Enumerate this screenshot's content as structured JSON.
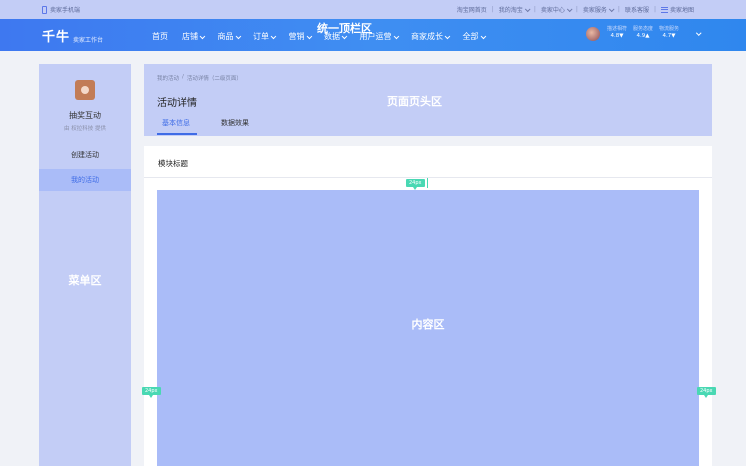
{
  "utilbar": {
    "left_label": "卖家手机端",
    "links": [
      {
        "label": "淘宝网首页",
        "dropdown": false
      },
      {
        "label": "我的淘宝",
        "dropdown": true
      },
      {
        "label": "卖家中心",
        "dropdown": true
      },
      {
        "label": "卖家服务",
        "dropdown": true
      },
      {
        "label": "联系客服",
        "dropdown": false
      },
      {
        "label": "卖家地图",
        "dropdown": false
      }
    ]
  },
  "navbar": {
    "logo": "千牛",
    "logo_sub": "卖家工作台",
    "overlay_label": "统一顶栏区",
    "items": [
      {
        "label": "首页",
        "dropdown": false
      },
      {
        "label": "店铺",
        "dropdown": true
      },
      {
        "label": "商品",
        "dropdown": true
      },
      {
        "label": "订单",
        "dropdown": true
      },
      {
        "label": "营销",
        "dropdown": true
      },
      {
        "label": "数据",
        "dropdown": true
      },
      {
        "label": "用户运营",
        "dropdown": true
      },
      {
        "label": "商家成长",
        "dropdown": true
      },
      {
        "label": "全部",
        "dropdown": true
      }
    ],
    "scores": [
      {
        "label": "描述相符",
        "value": "4.8▼"
      },
      {
        "label": "服务态度",
        "value": "4.9▲"
      },
      {
        "label": "物流服务",
        "value": "4.7▼"
      }
    ]
  },
  "sidebar": {
    "shop_name": "抽奖互动",
    "shop_by": "由 权拉科技 提供",
    "items": [
      {
        "label": "创建活动",
        "active": false
      },
      {
        "label": "我的活动",
        "active": true
      }
    ],
    "region_label": "菜单区"
  },
  "page_header": {
    "breadcrumb": [
      "我的活动",
      "活动详情（二级页面）"
    ],
    "title": "活动详情",
    "region_label": "页面页头区",
    "tabs": [
      {
        "label": "基本信息",
        "active": true
      },
      {
        "label": "数据效果",
        "active": false
      }
    ]
  },
  "card": {
    "title": "模块标题",
    "content_label": "内容区",
    "spacing_label": "24px"
  },
  "colors": {
    "nav_gradient_start": "#3e78f0",
    "accent": "#3f6ce6",
    "region_light": "#c3cdf6",
    "region_mid": "#aabcf8",
    "spacing_marker": "#49d8b3"
  }
}
